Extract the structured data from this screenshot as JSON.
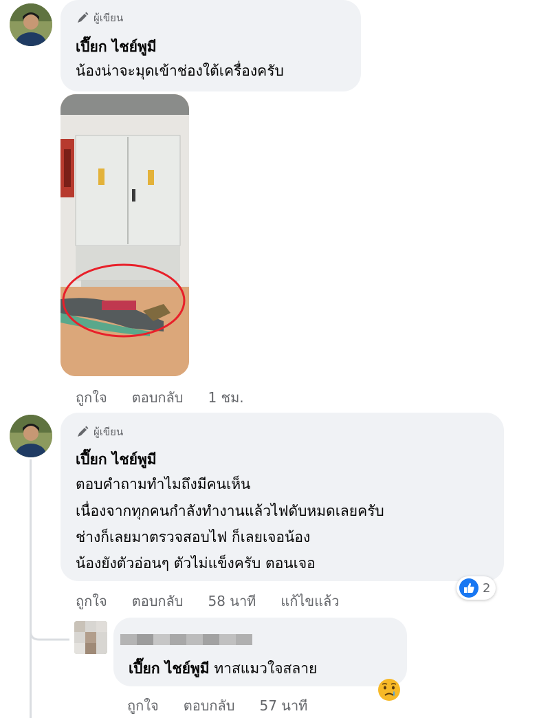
{
  "comments": [
    {
      "badge": "ผู้เขียน",
      "author": "เปี๊ยก ไชย์พูมี",
      "lines": [
        "น้องน่าจะมุดเข้าช่องใต้เครื่องครับ"
      ],
      "actions": {
        "like": "ถูกใจ",
        "reply": "ตอบกลับ",
        "time": "1 ชม."
      }
    },
    {
      "badge": "ผู้เขียน",
      "author": "เปี๊ยก ไชย์พูมี",
      "lines": [
        "ตอบคำถามทำไมถึงมีคนเห็น",
        "เนื่องจากทุกคนกำลังทำงานแล้วไฟดับหมดเลยครับ",
        "ช่างก็เลยมาตรวจสอบไฟ ก็เลยเจอน้อง",
        "น้องยังตัวอ่อนๆ ตัวไม่แข็งครับ ตอนเจอ"
      ],
      "reaction_count": "2",
      "actions": {
        "like": "ถูกใจ",
        "reply": "ตอบกลับ",
        "time": "58 นาที",
        "edited": "แก้ไขแล้ว"
      }
    }
  ],
  "reply": {
    "tag": "เปี๊ยก ไชย์พูมี",
    "text": "ทาสแมวใจสลาย",
    "actions": {
      "like": "ถูกใจ",
      "reply": "ตอบกลับ",
      "time": "57 นาที"
    }
  },
  "icons": {
    "author_badge": "pencil-icon",
    "like_reaction": "thumbs-up-icon",
    "sad_emoji": "crying-face-icon"
  },
  "colors": {
    "bubble": "#f0f2f5",
    "muted_text": "#65676b",
    "like_blue": "#1877f2",
    "circle_annotation": "#e8202a"
  }
}
